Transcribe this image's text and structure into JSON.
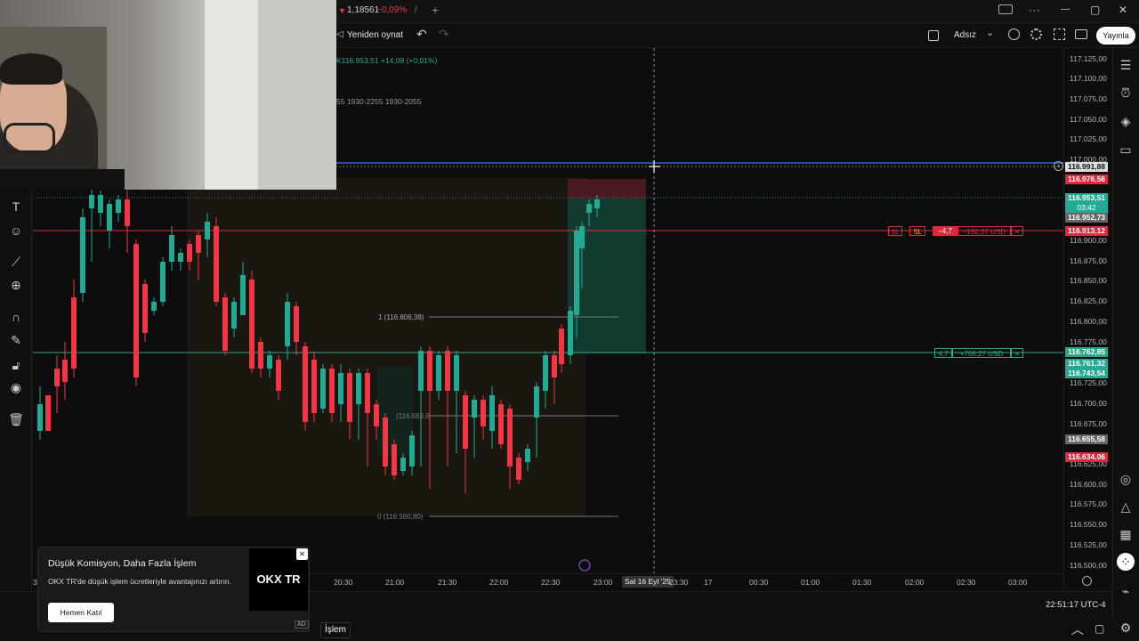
{
  "topbar": {
    "symbol_price": "1,18561",
    "symbol_change": "−0,09%",
    "down_arrow": "▼",
    "separator": "/",
    "add_tab": "+",
    "window_minimize": "—",
    "window_maximize": "▢",
    "window_close": "✕",
    "more": "⋯",
    "layout_icon": "layout-icon"
  },
  "toolbar": {
    "replay_label": "Yeniden oynat",
    "layout_name": "Adsız",
    "publish_label": "Yayınla",
    "undo": "↶",
    "redo": "↷",
    "dropdown": "⌄",
    "collapse": "◁"
  },
  "legend": {
    "symbol_suffix": "K",
    "price": "116.953,51",
    "change": "+14,09 (+0,01%)",
    "session_text": "55  1930-2255  1930-2055"
  },
  "price_axis": {
    "ticks": [
      "117.125,00",
      "117.100,00",
      "117.075,00",
      "117.050,00",
      "117.025,00",
      "117.000,00",
      "116.900,00",
      "116.875,00",
      "116.850,00",
      "116.825,00",
      "116.800,00",
      "116.775,00",
      "116.725,00",
      "116.700,00",
      "116.675,00",
      "116.625,00",
      "116.600,00",
      "116.575,00",
      "116.550,00",
      "116.525,00",
      "116.500,00"
    ],
    "tags": {
      "crosshair": "116.991,88",
      "red_top": "116.976,56",
      "last_price": "116.953,51",
      "countdown": "03:42",
      "gray_1": "116.952,73",
      "stop_loss": "116.913,12",
      "take_profit": "116.762,85",
      "green_2": "116.761,32",
      "green_3": "116.743,54",
      "gray_2": "116.655,58",
      "red_bottom": "116.634,06"
    }
  },
  "time_axis": {
    "ticks": [
      "30",
      "20:30",
      "21:00",
      "21:30",
      "22:00",
      "22:30",
      "23:00",
      "Sal 16 Eyl '25",
      "23:30",
      "17",
      "00:30",
      "01:00",
      "01:30",
      "02:00",
      "02:30",
      "03:00"
    ]
  },
  "orders": {
    "sl_qty": "1L",
    "sl_label": "SL",
    "sl_points": "−4,7",
    "sl_usd": "−192,37 USD",
    "tp_points": "4,7",
    "tp_usd": "+706,27 USD",
    "close": "✕"
  },
  "fib": {
    "level_1": "1 (116.806,38)",
    "level_mid": "(116.683,6",
    "level_0": "0 (116.560,80)"
  },
  "ad": {
    "title": "Düşük Komisyon, Daha Fazla İşlem",
    "body": "OKX TR'de düşük işlem ücretleriyle avantajınızı artırın.",
    "cta": "Hemen Katıl",
    "logo": "OKX TR",
    "badge": "AD",
    "close": "✕"
  },
  "bottom": {
    "clock": "22:51:17 UTC-4",
    "tab_trade": "İşlem",
    "collapse_up": "︿",
    "maximize": "▢"
  },
  "left_tools": [
    "text-icon",
    "emoji-icon",
    "ruler-icon",
    "zoom-icon",
    "magnet-icon",
    "lock-drawing-icon",
    "lock-icon",
    "eye-icon",
    "trash-icon"
  ],
  "right_tools": [
    "watchlist-icon",
    "alert-icon",
    "layers-icon",
    "chat-icon",
    "target-icon",
    "triangle-icon",
    "calendar-icon",
    "grid-icon",
    "broadcast-icon",
    "settings-icon"
  ],
  "colors": {
    "up": "#22ab94",
    "down": "#f23645",
    "crosshair_line": "#2962ff",
    "stop_line": "#e0273e",
    "tp_line": "#2aa889",
    "bg": "#0d0d0d"
  }
}
